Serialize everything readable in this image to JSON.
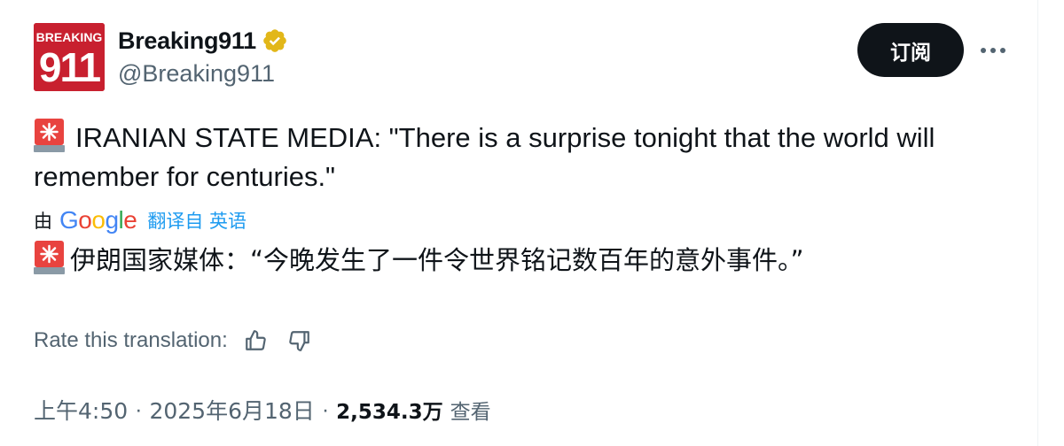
{
  "author": {
    "display_name": "Breaking911",
    "handle": "@Breaking911",
    "avatar_text_top": "BREAKING",
    "avatar_text_main": "911",
    "verified_icon": "verified-gold-badge"
  },
  "actions": {
    "subscribe_label": "订阅",
    "more_icon": "ellipsis-icon"
  },
  "tweet": {
    "emoji": "siren-emoji",
    "text": "IRANIAN STATE MEDIA: \"There is a surprise tonight that the world will remember for centuries.\""
  },
  "translation": {
    "by_label": "由",
    "provider": "Google",
    "link_text": "翻译自 英语",
    "text": "伊朗国家媒体：“今晚发生了一件令世界铭记数百年的意外事件。”"
  },
  "rating": {
    "label": "Rate this translation:",
    "thumbs_up_icon": "thumbs-up-icon",
    "thumbs_down_icon": "thumbs-down-icon"
  },
  "meta": {
    "time": "上午4:50",
    "separator": "·",
    "date": "2025年6月18日",
    "views_count": "2,534.3万",
    "views_label": "查看"
  },
  "colors": {
    "text_primary": "#0f1419",
    "text_secondary": "#536471",
    "link_blue": "#1d9bf0",
    "button_dark": "#0f1419",
    "avatar_red": "#c8202f",
    "verified_gold": "#e2b719"
  }
}
